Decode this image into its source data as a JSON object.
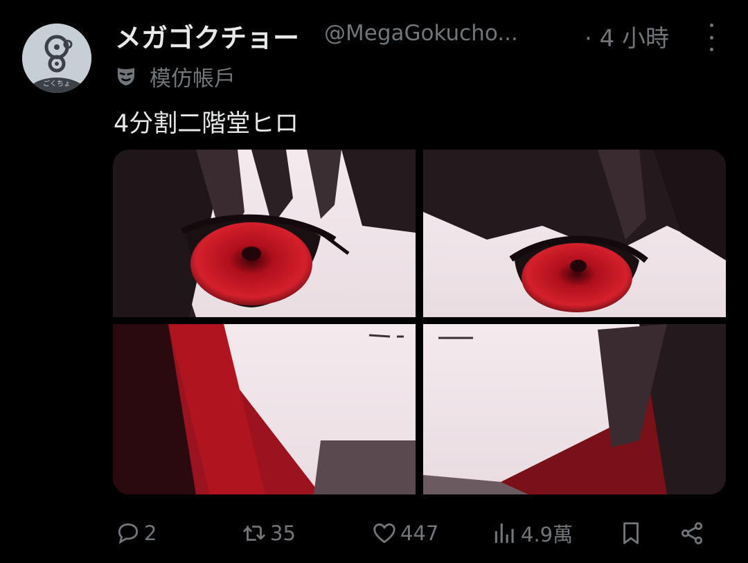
{
  "tweet": {
    "display_name": "メガゴクチョー",
    "handle": "@MegaGokucho...",
    "time": "· 4 小時",
    "parody_label": "模仿帳戶",
    "text": "4分割二階堂ヒロ",
    "avatar_text": "ごくちょ"
  },
  "actions": {
    "replies": "2",
    "reposts": "35",
    "likes": "447",
    "views": "4.9萬"
  },
  "icons": {
    "more": "more-icon",
    "parody": "mask-icon",
    "reply": "reply-icon",
    "repost": "repost-icon",
    "like": "heart-icon",
    "views": "views-icon",
    "bookmark": "bookmark-icon",
    "share": "share-icon"
  },
  "colors": {
    "background": "#000000",
    "primary_text": "#e7e9ea",
    "secondary_text": "#71767b",
    "eye_red": "#c4101c"
  }
}
